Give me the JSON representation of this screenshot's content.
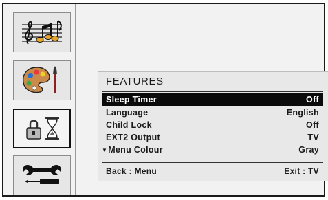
{
  "sidebar": {
    "items": [
      {
        "icon": "music-notes-icon"
      },
      {
        "icon": "palette-icon"
      },
      {
        "icon": "lock-hourglass-icon",
        "selected": true
      },
      {
        "icon": "tools-icon"
      }
    ]
  },
  "menu": {
    "title": "FEATURES",
    "rows": [
      {
        "label": "Sleep Timer",
        "value": "Off",
        "selected": true
      },
      {
        "label": "Language",
        "value": "English"
      },
      {
        "label": "Child Lock",
        "value": "Off"
      },
      {
        "label": "EXT2 Output",
        "value": "TV"
      },
      {
        "label": "Menu Colour",
        "value": "Gray",
        "more_indicator": "▼"
      }
    ],
    "footer": {
      "back": "Back : Menu",
      "exit": "Exit : TV"
    }
  },
  "colors": {
    "selected_row_bg": "#0b0b0b",
    "panel_bg": "#e8e8e8",
    "frame_border": "#1a1a1a"
  }
}
